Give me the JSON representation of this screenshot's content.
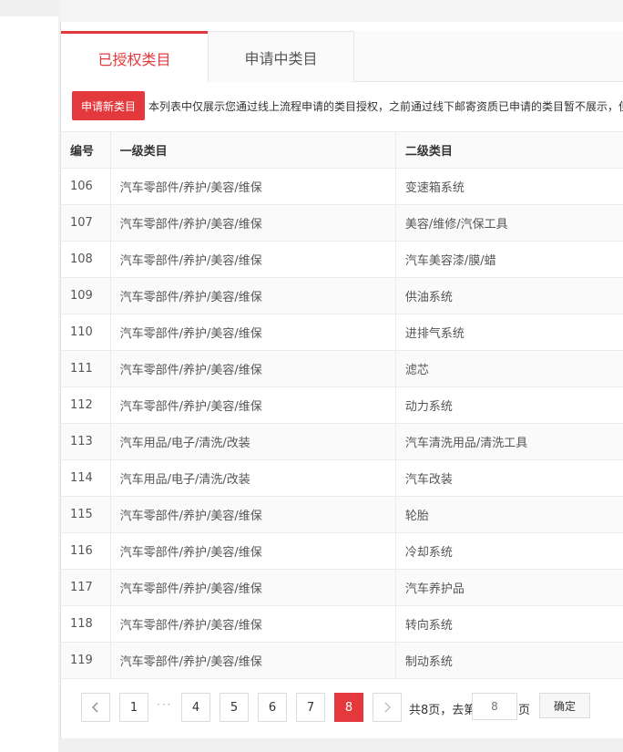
{
  "tabs": {
    "authorized": "已授权类目",
    "applying": "申请中类目"
  },
  "toolbar": {
    "apply_button": "申请新类目",
    "notice": "本列表中仅展示您通过线上流程申请的类目授权，之前通过线下邮寄资质已申请的类目暂不展示，但"
  },
  "table": {
    "headers": {
      "num": "编号",
      "level1": "一级类目",
      "level2": "二级类目"
    },
    "rows": [
      {
        "num": "106",
        "level1": "汽车零部件/养护/美容/维保",
        "level2": "变速箱系统"
      },
      {
        "num": "107",
        "level1": "汽车零部件/养护/美容/维保",
        "level2": "美容/维修/汽保工具"
      },
      {
        "num": "108",
        "level1": "汽车零部件/养护/美容/维保",
        "level2": "汽车美容漆/膜/蜡"
      },
      {
        "num": "109",
        "level1": "汽车零部件/养护/美容/维保",
        "level2": "供油系统"
      },
      {
        "num": "110",
        "level1": "汽车零部件/养护/美容/维保",
        "level2": "进排气系统"
      },
      {
        "num": "111",
        "level1": "汽车零部件/养护/美容/维保",
        "level2": "滤芯"
      },
      {
        "num": "112",
        "level1": "汽车零部件/养护/美容/维保",
        "level2": "动力系统"
      },
      {
        "num": "113",
        "level1": "汽车用品/电子/清洗/改装",
        "level2": "汽车清洗用品/清洗工具"
      },
      {
        "num": "114",
        "level1": "汽车用品/电子/清洗/改装",
        "level2": "汽车改装"
      },
      {
        "num": "115",
        "level1": "汽车零部件/养护/美容/维保",
        "level2": "轮胎"
      },
      {
        "num": "116",
        "level1": "汽车零部件/养护/美容/维保",
        "level2": "冷却系统"
      },
      {
        "num": "117",
        "level1": "汽车零部件/养护/美容/维保",
        "level2": "汽车养护品"
      },
      {
        "num": "118",
        "level1": "汽车零部件/养护/美容/维保",
        "level2": "转向系统"
      },
      {
        "num": "119",
        "level1": "汽车零部件/养护/美容/维保",
        "level2": "制动系统"
      }
    ]
  },
  "pagination": {
    "prev_icon": "chevron-left-icon",
    "next_icon": "chevron-right-icon",
    "first": "1",
    "ellipsis": "···",
    "pages": [
      "4",
      "5",
      "6",
      "7"
    ],
    "current": "8",
    "total_text": "共8页，去第",
    "page_input_placeholder": "8",
    "page_suffix": "页",
    "confirm": "确定"
  },
  "colors": {
    "accent": "#e4393c"
  }
}
